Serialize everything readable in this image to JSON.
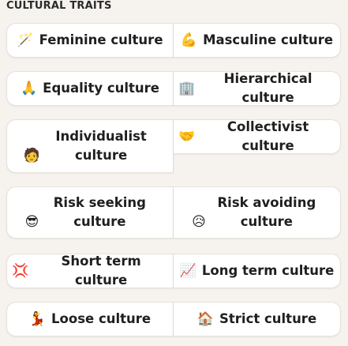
{
  "section_title": "CULTURAL TRAITS",
  "traits": [
    {
      "emoji": "🪄",
      "label": "Feminine culture",
      "icon": "wand-icon"
    },
    {
      "emoji": "💪",
      "label": "Masculine culture",
      "icon": "flexed-biceps-icon"
    },
    {
      "emoji": "🙏",
      "label": "Equality culture",
      "icon": "folded-hands-icon"
    },
    {
      "emoji": "🏢",
      "label": "Hierarchical culture",
      "icon": "office-building-icon"
    },
    {
      "emoji": "🧑",
      "label": "Individualist culture",
      "icon": "person-icon"
    },
    {
      "emoji": "🤝",
      "label": "Collectivist culture",
      "icon": "handshake-icon"
    },
    {
      "emoji": "😎",
      "label": "Risk seeking culture",
      "icon": "sunglasses-face-icon"
    },
    {
      "emoji": "😥",
      "label": "Risk avoiding culture",
      "icon": "worried-face-icon"
    },
    {
      "emoji": "💢",
      "label": "Short term culture",
      "icon": "collision-icon"
    },
    {
      "emoji": "📈",
      "label": "Long term culture",
      "icon": "chart-up-icon"
    },
    {
      "emoji": "💃",
      "label": "Loose culture",
      "icon": "dancer-icon"
    },
    {
      "emoji": "🏠",
      "label": "Strict culture",
      "icon": "house-icon"
    }
  ]
}
